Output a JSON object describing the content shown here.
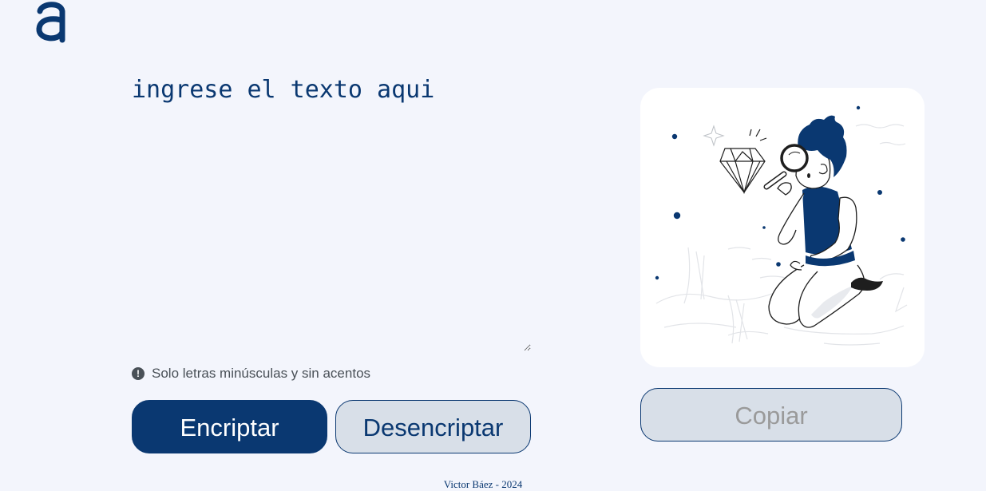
{
  "header": {
    "logo_icon": "alura-a-logo-icon",
    "logo_color": "#0a3871"
  },
  "input": {
    "placeholder": "ingrese el texto aqui",
    "value": ""
  },
  "hint": {
    "icon": "exclamation-circle-icon",
    "text": "Solo letras minúsculas y sin acentos"
  },
  "actions": {
    "encrypt_label": "Encriptar",
    "decrypt_label": "Desencriptar"
  },
  "output": {
    "illustration": "person-searching-diamond-illustration",
    "copy_label": "Copiar"
  },
  "footer": {
    "text": "Victor Báez - 2024"
  },
  "colors": {
    "primary": "#0a3871",
    "background": "#f3f5fc",
    "secondary": "#d8dfe8"
  }
}
